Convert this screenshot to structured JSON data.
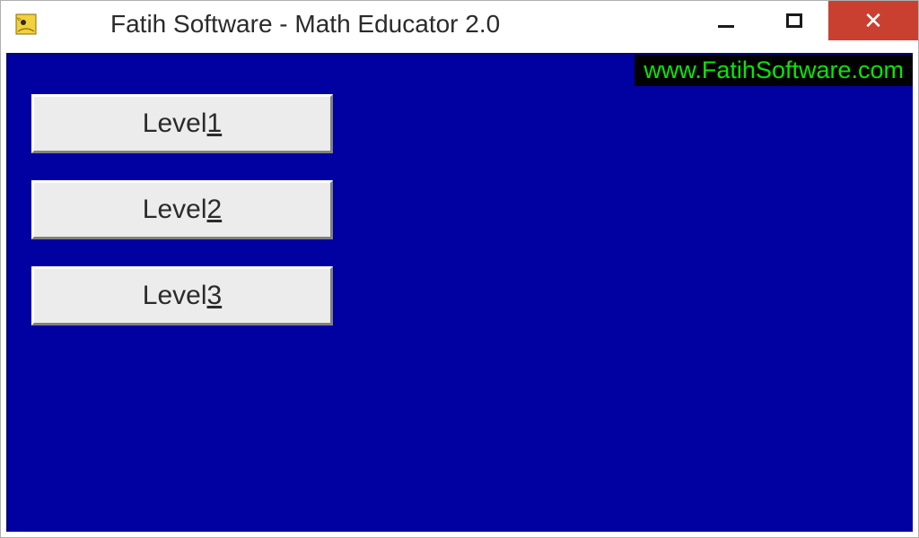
{
  "window": {
    "title": "Fatih Software - Math Educator 2.0"
  },
  "banner": {
    "url": "www.FatihSoftware.com"
  },
  "buttons": {
    "level1_prefix": "Level ",
    "level1_mnemonic": "1",
    "level2_prefix": "Level ",
    "level2_mnemonic": "2",
    "level3_prefix": "Level ",
    "level3_mnemonic": "3"
  },
  "colors": {
    "client_bg": "#0101a1",
    "url_fg": "#07e607",
    "close_bg": "#c94031"
  }
}
